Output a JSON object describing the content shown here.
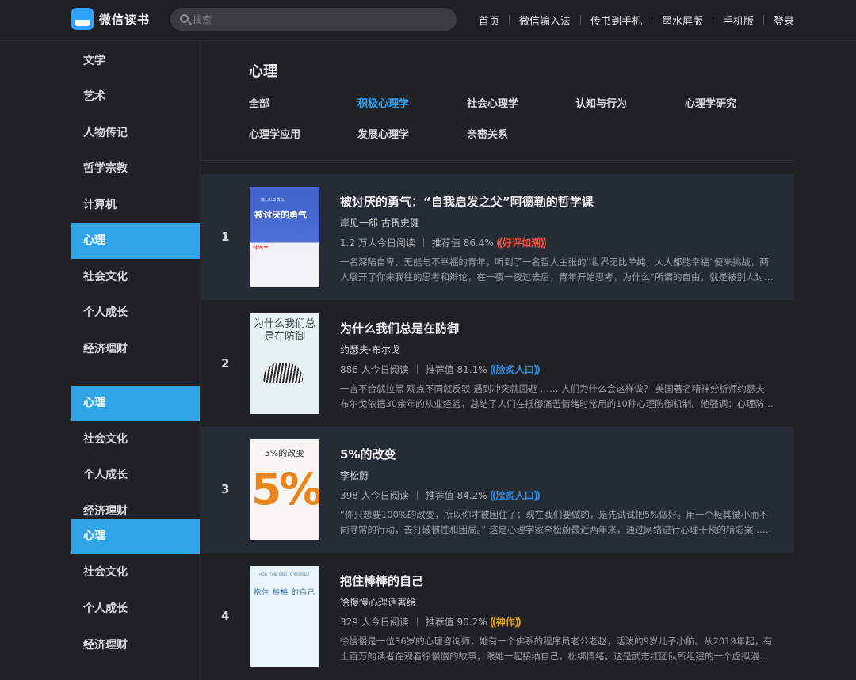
{
  "header": {
    "logo_text": "微信读书",
    "search_placeholder": "搜索",
    "nav": [
      "首页",
      "微信输入法",
      "传书到手机",
      "墨水屏版",
      "手机版",
      "登录"
    ]
  },
  "sidebar": {
    "items": [
      "文学",
      "艺术",
      "人物传记",
      "哲学宗教",
      "计算机",
      "心理",
      "社会文化",
      "个人成长",
      "经济理财",
      "心理",
      "社会文化",
      "个人成长",
      "经济理财",
      "心理",
      "社会文化",
      "个人成长",
      "经济理财"
    ],
    "active_color": "#2fa4e7"
  },
  "main": {
    "title": "心理",
    "categories": [
      "全部",
      "积极心理学",
      "社会心理学",
      "认知与行为",
      "心理学研究",
      "心理学应用",
      "发展心理学",
      "亲密关系"
    ],
    "active_category": "积极心理学"
  },
  "books": [
    {
      "rank": "1",
      "title": "被讨厌的勇气：“自我启发之父”阿德勒的哲学课",
      "author": "岸见一郎 古贺史健",
      "reads": "1.2 万人今日阅读",
      "recommend": "推荐值 86.4%",
      "badge": "好评如潮",
      "badge_color": "#f0533f",
      "desc": "一名深陷自卑、无能与不幸福的青年，听到了一名哲人主张的“世界无比单纯，人人都能幸福”便来挑战，两人展开了你来我往的思考和辩论，在一夜一夜过去后，青年开始思考，为什么“所谓的自由，就是被别人讨厌”……",
      "cover": {
        "title": "被讨厌的勇气",
        "subtitle": "嫌われる勇気",
        "ribbon": "“好气””"
      }
    },
    {
      "rank": "2",
      "title": "为什么我们总是在防御",
      "author": "约瑟夫·布尔戈",
      "reads": "886 人今日阅读",
      "recommend": "推荐值 81.1%",
      "badge": "脸炙人口",
      "badge_color": "#2f8fe8",
      "desc": "一言不合就拉黑 观点不同就反驳 遇到冲突就回避 …… 人们为什么会这样做？ 美国著名精神分析师约瑟夫·布尔戈依据30余年的从业经验，总结了人们在抵御痛苦情绪时常用的10种心理防御机制。他强调：心理防御……",
      "cover": {
        "title": "为什么我们总是在防御"
      }
    },
    {
      "rank": "3",
      "title": "5%的改变",
      "author": "李松蔚",
      "reads": "398 人今日阅读",
      "recommend": "推荐值 84.2%",
      "badge": "脍炙人口",
      "badge_color": "#2f8fe8",
      "desc": "“你只想要100%的改变，所以你才被困住了；现在我们要做的，是先试试把5%做好。用一个极其微小而不同寻常的行动，去打破惯性和困局。” 这是心理学家李松蔚最近两年来，通过网络进行心理干预的精彩案……",
      "cover": {
        "title": "5%的改变",
        "big": "5%"
      }
    },
    {
      "rank": "4",
      "title": "抱住棒棒的自己",
      "author": "徐慢慢心理话著绘",
      "reads": "329 人今日阅读",
      "recommend": "推荐值 90.2%",
      "badge": "神作",
      "badge_color": "#e6a21b",
      "desc": "徐慢慢是一位36岁的心理咨询师，她有一个佛系的程序员老公老赵，活泼的9岁儿子小航。从2019年起，有上百万的读者在观看徐慢慢的故事，跟她一起接纳自己，松绑情绪。这是武志红团队所组建的一个虚拟漫画……",
      "cover": {
        "title": "抱住 棒棒 的自己",
        "subtitle": "HOW TO BE KIND TO YOURSELF"
      }
    }
  ]
}
